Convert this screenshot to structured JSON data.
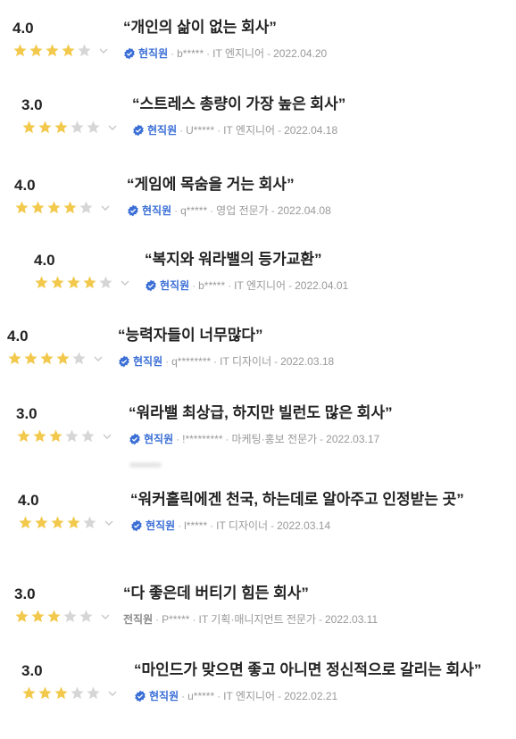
{
  "colors": {
    "star_filled": "#f2c94c",
    "star_empty": "#d6d6d6",
    "badge": "#3b6fd6"
  },
  "reviews": [
    {
      "score": "4.0",
      "stars_filled": 4,
      "title": "“개인의 삶이 없는 회사”",
      "verified": true,
      "status": "현직원",
      "user": "b*****",
      "role": "IT 엔지니어",
      "date": "2022.04.20"
    },
    {
      "score": "3.0",
      "stars_filled": 3,
      "title": "“스트레스 총량이 가장 높은 회사”",
      "verified": true,
      "status": "현직원",
      "user": "U*****",
      "role": "IT 엔지니어",
      "date": "2022.04.18"
    },
    {
      "score": "4.0",
      "stars_filled": 4,
      "title": "“게임에 목숨을 거는 회사”",
      "verified": true,
      "status": "현직원",
      "user": "q*****",
      "role": "영업 전문가",
      "date": "2022.04.08"
    },
    {
      "score": "4.0",
      "stars_filled": 4,
      "title": "“복지와 워라밸의 등가교환”",
      "verified": true,
      "status": "현직원",
      "user": "b*****",
      "role": "IT 엔지니어",
      "date": "2022.04.01"
    },
    {
      "score": "4.0",
      "stars_filled": 4,
      "title": "“능력자들이 너무많다”",
      "verified": true,
      "status": "현직원",
      "user": "q********",
      "role": "IT 디자이너",
      "date": "2022.03.18"
    },
    {
      "score": "3.0",
      "stars_filled": 3,
      "title": "“워라밸 최상급, 하지만 빌런도 많은 회사”",
      "verified": true,
      "status": "현직원",
      "user": "!*********",
      "role": "마케팅·홍보 전문가",
      "date": "2022.03.17"
    },
    {
      "score": "4.0",
      "stars_filled": 4,
      "title": "“워커홀릭에겐 천국, 하는데로 알아주고 인정받는 곳”",
      "verified": true,
      "status": "현직원",
      "user": "l*****",
      "role": "IT 디자이너",
      "date": "2022.03.14"
    },
    {
      "score": "3.0",
      "stars_filled": 3,
      "title": "“다 좋은데 버티기 힘든 회사”",
      "verified": false,
      "status": "전직원",
      "user": "P*****",
      "role": "IT 기획·매니지먼트 전문가",
      "date": "2022.03.11"
    },
    {
      "score": "3.0",
      "stars_filled": 3,
      "title": "“마인드가 맞으면 좋고 아니면 정신적으로 갈리는 회사”",
      "verified": true,
      "status": "현직원",
      "user": "u*****",
      "role": "IT 엔지니어",
      "date": "2022.02.21"
    }
  ]
}
